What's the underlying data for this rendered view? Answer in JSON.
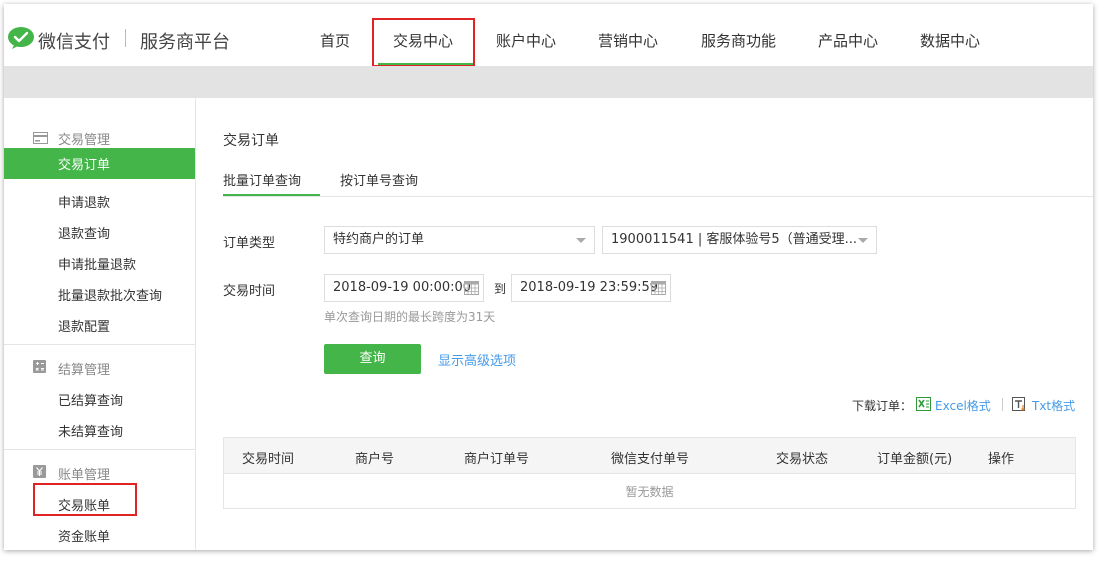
{
  "header": {
    "brand": "微信支付",
    "platform": "服务商平台",
    "nav": [
      "首页",
      "交易中心",
      "账户中心",
      "营销中心",
      "服务商功能",
      "产品中心",
      "数据中心"
    ],
    "active_nav": "交易中心"
  },
  "sidebar": {
    "groups": [
      {
        "title": "交易管理",
        "items": [
          "交易订单",
          "申请退款",
          "退款查询",
          "申请批量退款",
          "批量退款批次查询",
          "退款配置"
        ]
      },
      {
        "title": "结算管理",
        "items": [
          "已结算查询",
          "未结算查询"
        ]
      },
      {
        "title": "账单管理",
        "items": [
          "交易账单",
          "资金账单"
        ]
      }
    ],
    "active_item": "交易订单"
  },
  "main": {
    "title": "交易订单",
    "tabs": [
      "批量订单查询",
      "按订单号查询"
    ],
    "form": {
      "order_type_label": "订单类型",
      "order_type_value": "特约商户的订单",
      "merchant_value": "1900011541 | 客服体验号5（普通受理...",
      "time_label": "交易时间",
      "start_time": "2018-09-19 00:00:00",
      "to": "到",
      "end_time": "2018-09-19 23:59:59",
      "hint": "单次查询日期的最长跨度为31天",
      "query_button": "查询",
      "advanced_link": "显示高级选项"
    },
    "download": {
      "label": "下载订单：",
      "excel": "Excel格式",
      "txt": "Txt格式"
    },
    "table": {
      "headers": [
        "交易时间",
        "商户号",
        "商户订单号",
        "微信支付单号",
        "交易状态",
        "订单金额(元)",
        "操作"
      ],
      "empty_text": "暂无数据"
    }
  },
  "colors": {
    "accent": "#44b549",
    "highlight": "#e02424",
    "link": "#459ae9"
  }
}
